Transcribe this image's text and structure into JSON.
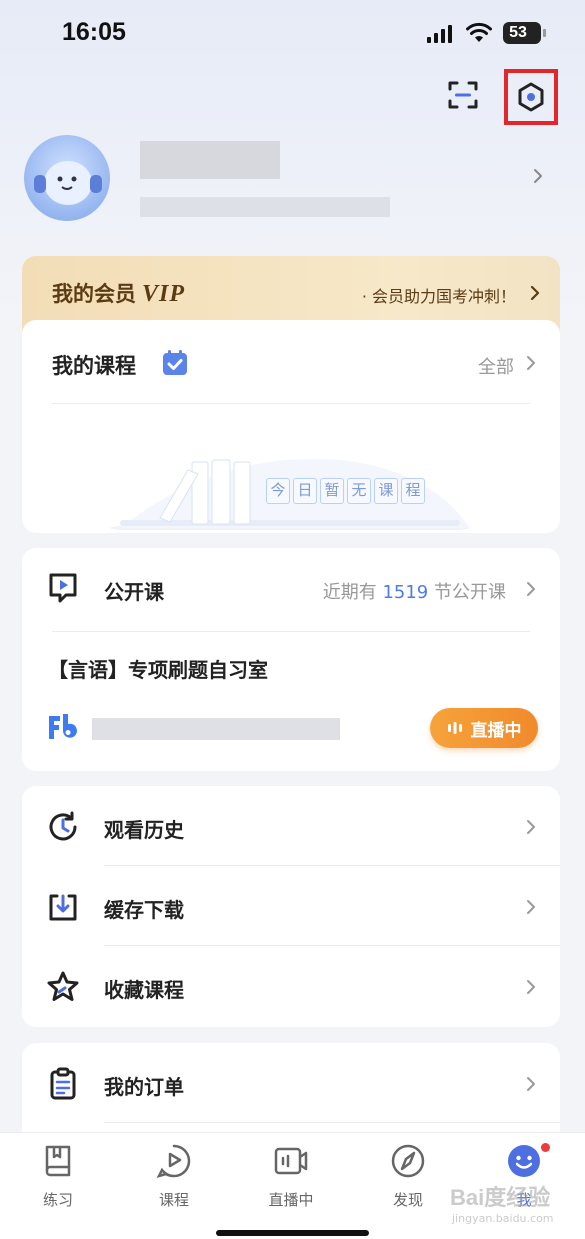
{
  "status_bar": {
    "time": "16:05",
    "battery": "53"
  },
  "profile": {},
  "vip": {
    "title": "我的会员",
    "badge": "VIP",
    "slogan": "· 会员助力国考冲刺！"
  },
  "my_courses": {
    "title": "我的课程",
    "all_label": "全部",
    "empty_chars": [
      "今",
      "日",
      "暂",
      "无",
      "课",
      "程"
    ]
  },
  "public_course": {
    "title": "公开课",
    "count_prefix": "近期有 ",
    "count": "1519",
    "count_suffix": " 节公开课",
    "lesson_title": "【言语】专项刷题自习室",
    "live_label": "直播中"
  },
  "menu": [
    {
      "label": "观看历史",
      "icon": "history-icon"
    },
    {
      "label": "缓存下载",
      "icon": "download-icon"
    },
    {
      "label": "收藏课程",
      "icon": "star-icon"
    },
    {
      "label": "我的订单",
      "icon": "order-icon"
    }
  ],
  "tabs": [
    {
      "label": "练习",
      "icon": "book-icon"
    },
    {
      "label": "课程",
      "icon": "play-bubble-icon"
    },
    {
      "label": "直播中",
      "icon": "live-camera-icon"
    },
    {
      "label": "发现",
      "icon": "compass-icon"
    },
    {
      "label": "我",
      "icon": "me-smile-icon",
      "active": true,
      "has_badge": true
    }
  ],
  "watermark": {
    "main": "Bai度经验",
    "sub": "jingyan.baidu.com"
  },
  "colors": {
    "accent": "#4d6fe0",
    "live": "#f08a2c",
    "highlight_box": "#e2262a",
    "vip_text": "#5b3b14"
  }
}
